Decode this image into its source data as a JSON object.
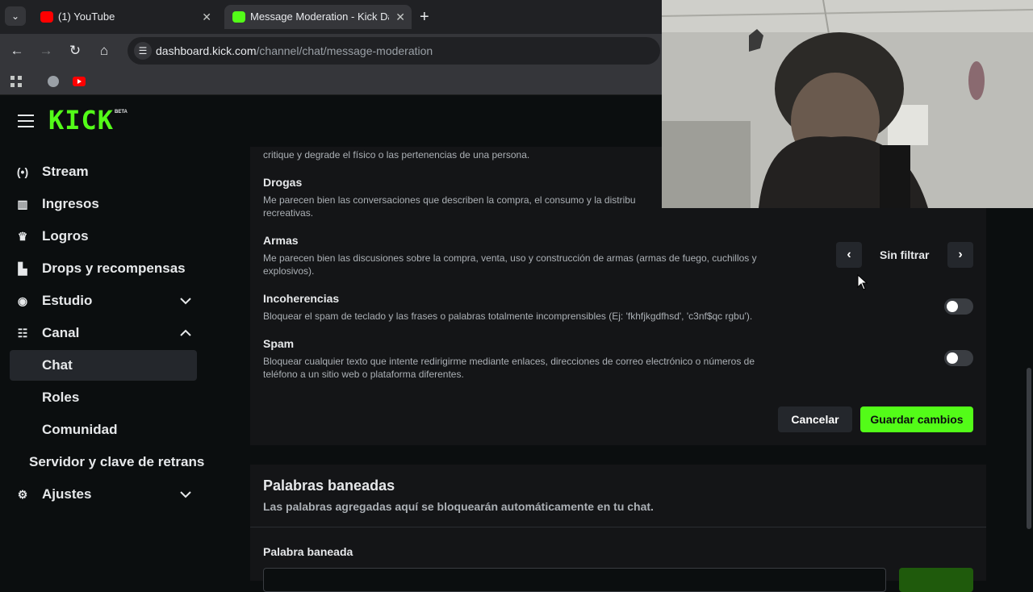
{
  "browser": {
    "tabs": [
      {
        "title": "(1) YouTube",
        "favicon": "youtube-icon"
      },
      {
        "title": "Message Moderation - Kick Dashboard",
        "favicon": "kick-icon",
        "active": true
      }
    ],
    "url_host": "dashboard.kick.com",
    "url_path": "/channel/chat/message-moderation"
  },
  "brand": {
    "logo": "KICK",
    "badge": "BETA",
    "accent": "#53fc18"
  },
  "sidebar": {
    "items": [
      {
        "label": "Stream",
        "icon": "broadcast-icon"
      },
      {
        "label": "Ingresos",
        "icon": "chart-icon"
      },
      {
        "label": "Logros",
        "icon": "trophy-icon"
      },
      {
        "label": "Drops y recompensas",
        "icon": "gift-icon"
      },
      {
        "label": "Estudio",
        "icon": "studio-icon",
        "expanded": false
      },
      {
        "label": "Canal",
        "icon": "channel-icon",
        "expanded": true
      },
      {
        "label": "Chat",
        "active": true
      },
      {
        "label": "Roles"
      },
      {
        "label": "Comunidad"
      },
      {
        "label": "Servidor y clave de retrans"
      },
      {
        "label": "Ajustes",
        "icon": "gear-icon",
        "expanded": false
      }
    ]
  },
  "moderation": {
    "partial_desc": "critique y degrade el físico o las pertenencias de una persona.",
    "rows": [
      {
        "title": "Drogas",
        "desc": "Me parecen bien las conversaciones que describen la compra, el consumo y la distribu",
        "desc2": "recreativas."
      },
      {
        "title": "Armas",
        "desc": "Me parecen bien las discusiones sobre la compra, venta, uso y construcción de armas (armas de fuego, cuchillos y",
        "desc2": "explosivos).",
        "filter": "Sin filtrar"
      },
      {
        "title": "Incoherencias",
        "desc": "Bloquear el spam de teclado y las frases o palabras totalmente incomprensibles (Ej: 'fkhfjkgdfhsd', 'c3nf$qc rgbu').",
        "toggle": false
      },
      {
        "title": "Spam",
        "desc": "Bloquear cualquier texto que intente redirigirme mediante enlaces, direcciones de correo electrónico o números de",
        "desc2": "teléfono a un sitio web o plataforma diferentes.",
        "toggle": false
      }
    ],
    "cancel_label": "Cancelar",
    "save_label": "Guardar cambios"
  },
  "banned": {
    "title": "Palabras baneadas",
    "subtitle": "Las palabras agregadas aquí se bloquearán automáticamente en tu chat.",
    "field_label": "Palabra baneada"
  }
}
